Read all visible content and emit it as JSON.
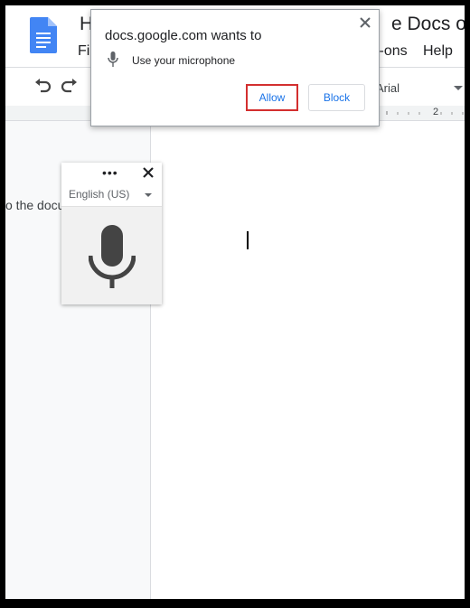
{
  "document": {
    "title_left": "H",
    "title_right": "e Docs on",
    "menu": {
      "file_partial": "Fi",
      "addons_partial": "l-ons",
      "help": "Help"
    }
  },
  "toolbar": {
    "undo_icon": "undo-icon",
    "redo_icon": "redo-icon",
    "font_name": "Arial",
    "ruler_number": "2"
  },
  "sidebar": {
    "partial_text": "o the docu"
  },
  "voice_typing": {
    "menu_dots": "•••",
    "language": "English (US)"
  },
  "permission_popup": {
    "title": "docs.google.com wants to",
    "permission_text": "Use your microphone",
    "allow_label": "Allow",
    "block_label": "Block"
  },
  "colors": {
    "accent_blue": "#1a73e8",
    "highlight_red": "#d32f2f",
    "docs_blue": "#4285f4"
  }
}
